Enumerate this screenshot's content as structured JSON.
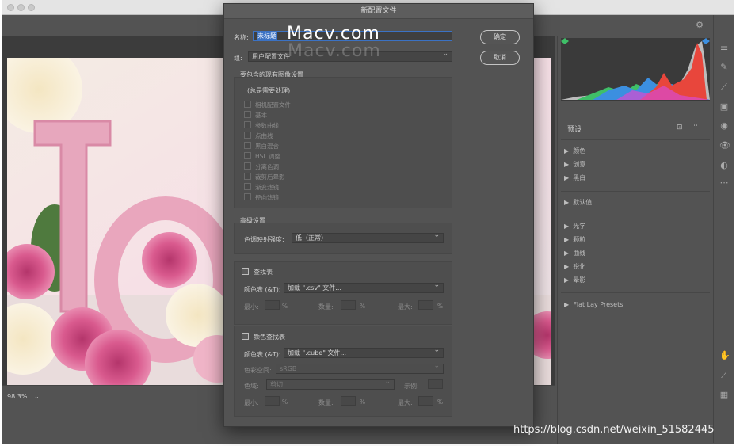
{
  "status": {
    "zoom": "98.3%"
  },
  "dialog": {
    "title": "新配置文件",
    "name_label": "名称:",
    "name_value": "未标题",
    "group_label": "组:",
    "group_value": "用户配置文件",
    "ok": "确定",
    "cancel": "取消",
    "existing_section": "要包含的现有图像设置",
    "always_processed": "(总是需要处理)",
    "checkboxes": [
      "相机配置文件",
      "基本",
      "参数曲线",
      "点曲线",
      "黑白混合",
      "HSL 调整",
      "分离色调",
      "裁剪后晕影",
      "渐变滤镜",
      "径向滤镜"
    ],
    "advanced_section": "高级设置",
    "tone_label": "色调映射强度:",
    "tone_value": "低（正常）",
    "lookup_section": "查找表",
    "color_table_label": "颜色表 (&T):",
    "lookup_load": "加载 \".csv\" 文件...",
    "min_label": "最小:",
    "count_label": "数量:",
    "max_label": "最大:",
    "pct": "%",
    "clut_section": "颜色查找表",
    "clut_load": "加载 \".cube\" 文件...",
    "color_space_label": "色彩空间:",
    "color_space_value": "sRGB",
    "gamut_label": "色域:",
    "gamut_value": "剪切",
    "sample_label": "示例:"
  },
  "presets": {
    "title": "预设",
    "group1": [
      "颜色",
      "创意",
      "黑白"
    ],
    "group2": [
      "默认值"
    ],
    "group3": [
      "光学",
      "颗粒",
      "曲线",
      "锐化",
      "晕影"
    ],
    "group4": [
      "Flat Lay Presets"
    ]
  },
  "watermark": {
    "main": "Macv.com",
    "ghost": "Macv.com"
  },
  "credit": "https://blog.csdn.net/weixin_51582445",
  "colors": {
    "dialog_bg": "#535353",
    "selection": "#3b72c4",
    "histogram_red": "#e8463c",
    "histogram_blue": "#3c8fe0"
  }
}
